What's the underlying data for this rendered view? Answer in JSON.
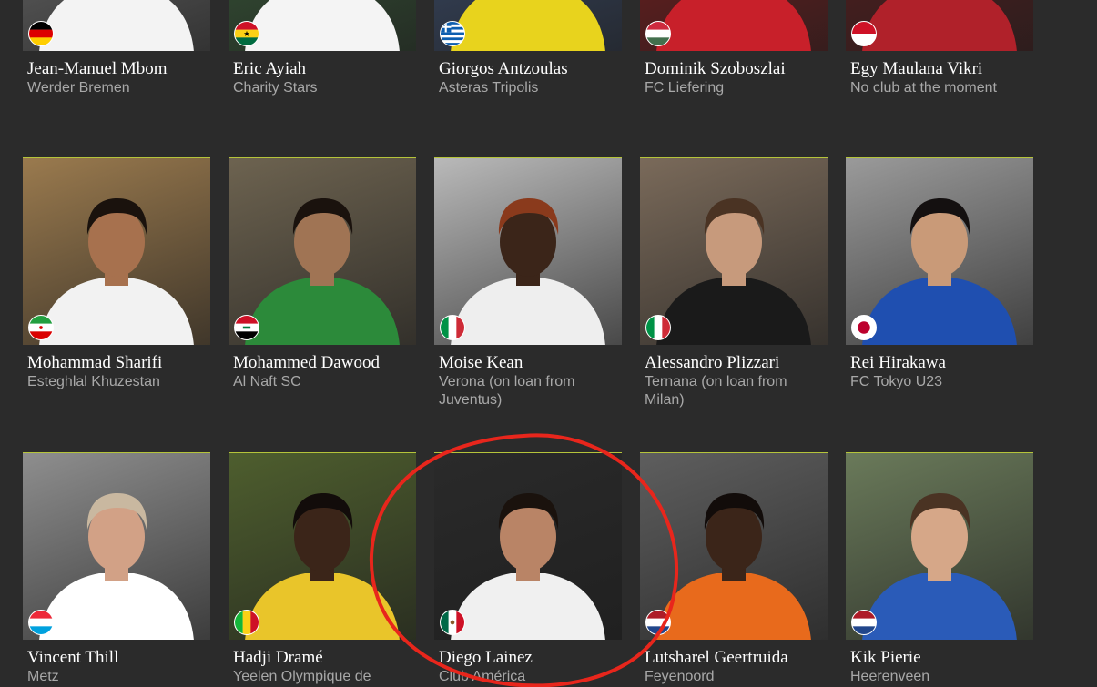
{
  "players": [
    {
      "name": "Jean-Manuel Mbom",
      "club": "Werder Bremen",
      "flag": "germany-flag-icon",
      "kit": "#f3f3f3",
      "bg": "#6e6e6e",
      "skin": "#a87a5a",
      "hair": "#1e1a17"
    },
    {
      "name": "Eric Ayiah",
      "club": "Charity Stars",
      "flag": "ghana-flag-icon",
      "kit": "#f4f4f4",
      "bg": "#3a5a3a",
      "skin": "#3f2a1e",
      "hair": "#120c0a"
    },
    {
      "name": "Giorgos Antzoulas",
      "club": "Asteras Tripolis",
      "flag": "greece-flag-icon",
      "kit": "#e8d31d",
      "bg": "#3d4d6a",
      "skin": "#b78663",
      "hair": "#2a1f16"
    },
    {
      "name": "Dominik Szoboszlai",
      "club": "FC Liefering",
      "flag": "hungary-flag-icon",
      "kit": "#c8202a",
      "bg": "#7a2020",
      "skin": "#d6a788",
      "hair": "#3a2a1e"
    },
    {
      "name": "Egy Maulana Vikri",
      "club": "No club at the moment",
      "flag": "indonesia-flag-icon",
      "kit": "#b0212a",
      "bg": "#5a2020",
      "skin": "#8a5b3d",
      "hair": "#15100d"
    },
    {
      "name": "Mohammad Sharifi",
      "club": "Esteghlal Khuzestan",
      "flag": "iran-flag-icon",
      "kit": "#f2f2f2",
      "bg": "#9a7a4e",
      "skin": "#a7714e",
      "hair": "#1a120d"
    },
    {
      "name": "Mohammed Dawood",
      "club": "Al Naft SC",
      "flag": "iraq-flag-icon",
      "kit": "#2c8a3a",
      "bg": "#6d6350",
      "skin": "#a07454",
      "hair": "#1a120d"
    },
    {
      "name": "Moise Kean",
      "club": "Verona (on loan from Juventus)",
      "flag": "italy-flag-icon",
      "kit": "#eeeeee",
      "bg": "#b9b9b9",
      "skin": "#3b2519",
      "hair": "#8a3a1c"
    },
    {
      "name": "Alessandro Plizzari",
      "club": "Ternana (on loan from Milan)",
      "flag": "italy-flag-icon",
      "kit": "#1a1a1a",
      "bg": "#7a6a5a",
      "skin": "#c79a7c",
      "hair": "#4a3323"
    },
    {
      "name": "Rei Hirakawa",
      "club": "FC Tokyo U23",
      "flag": "japan-flag-icon",
      "kit": "#1f4fb0",
      "bg": "#9a9a9a",
      "skin": "#c99a78",
      "hair": "#141010"
    },
    {
      "name": "Vincent Thill",
      "club": "Metz",
      "flag": "luxembourg-flag-icon",
      "kit": "#ffffff",
      "bg": "#8e8e8e",
      "skin": "#d2a186",
      "hair": "#c9b8a0"
    },
    {
      "name": "Hadji Dramé",
      "club": "Yeelen Olympique de",
      "flag": "mali-flag-icon",
      "kit": "#e9c52a",
      "bg": "#4e5e2e",
      "skin": "#3b2519",
      "hair": "#120c0a"
    },
    {
      "name": "Diego Lainez",
      "club": "Club América",
      "flag": "mexico-flag-icon",
      "kit": "#f0f0f0",
      "bg": "#2a2a2a",
      "skin": "#b98466",
      "hair": "#1a120d"
    },
    {
      "name": "Lutsharel Geertruida",
      "club": "Feyenoord",
      "flag": "netherlands-flag-icon",
      "kit": "#e86a1c",
      "bg": "#5e5e5e",
      "skin": "#3b2519",
      "hair": "#120c0a"
    },
    {
      "name": "Kik Pierie",
      "club": "Heerenveen",
      "flag": "netherlands-flag-icon",
      "kit": "#2a5bb8",
      "bg": "#6a7a5a",
      "skin": "#d6a788",
      "hair": "#4a3323"
    }
  ],
  "annotation": {
    "color": "#e8261c",
    "target": "Diego Lainez"
  }
}
